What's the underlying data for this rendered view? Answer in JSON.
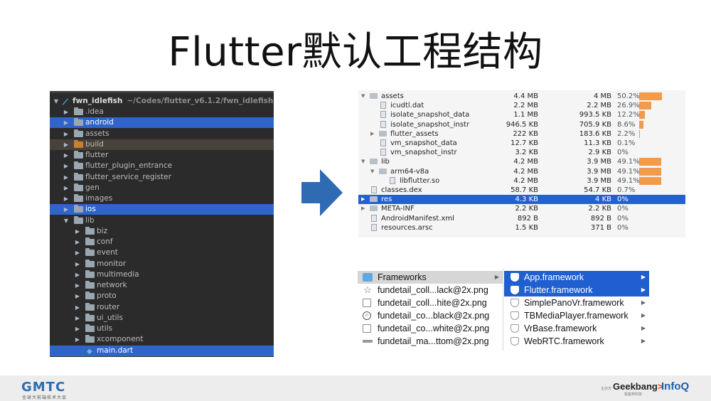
{
  "slide": {
    "title": "Flutter默认工程结构"
  },
  "ide_tree": {
    "root": {
      "name": "fwn_idlefish",
      "path": "~/Codes/flutter_v6.1.2/fwn_idlefish"
    },
    "items": [
      {
        "label": ".idea",
        "arrow": "▶"
      },
      {
        "label": "android",
        "arrow": "▶"
      },
      {
        "label": "assets",
        "arrow": "▶"
      },
      {
        "label": "build",
        "arrow": "▶"
      },
      {
        "label": "flutter",
        "arrow": "▶"
      },
      {
        "label": "flutter_plugin_entrance",
        "arrow": "▶"
      },
      {
        "label": "flutter_service_register",
        "arrow": "▶"
      },
      {
        "label": "gen",
        "arrow": "▶"
      },
      {
        "label": "images",
        "arrow": "▶"
      },
      {
        "label": "ios",
        "arrow": "▶"
      },
      {
        "label": "lib",
        "arrow": "▼"
      },
      {
        "label": "biz",
        "arrow": "▶"
      },
      {
        "label": "conf",
        "arrow": "▶"
      },
      {
        "label": "event",
        "arrow": "▶"
      },
      {
        "label": "monitor",
        "arrow": "▶"
      },
      {
        "label": "multimedia",
        "arrow": "▶"
      },
      {
        "label": "network",
        "arrow": "▶"
      },
      {
        "label": "proto",
        "arrow": "▶"
      },
      {
        "label": "router",
        "arrow": "▶"
      },
      {
        "label": "ui_utils",
        "arrow": "▶"
      },
      {
        "label": "utils",
        "arrow": "▶"
      },
      {
        "label": "xcomponent",
        "arrow": "▶"
      },
      {
        "label": "main.dart",
        "arrow": ""
      }
    ]
  },
  "apk_analyzer": {
    "rows": [
      {
        "name": "assets",
        "raw": "4.4 MB",
        "download": "4 MB",
        "pct": "50.2%",
        "bar": 0.502,
        "arrow": "▼"
      },
      {
        "name": "icudtl.dat",
        "raw": "2.2 MB",
        "download": "2.2 MB",
        "pct": "26.9%",
        "bar": 0.269,
        "arrow": ""
      },
      {
        "name": "isolate_snapshot_data",
        "raw": "1.1 MB",
        "download": "993.5 KB",
        "pct": "12.2%",
        "bar": 0.122,
        "arrow": ""
      },
      {
        "name": "isolate_snapshot_instr",
        "raw": "946.5 KB",
        "download": "705.9 KB",
        "pct": "8.6%",
        "bar": 0.086,
        "arrow": ""
      },
      {
        "name": "flutter_assets",
        "raw": "222 KB",
        "download": "183.6 KB",
        "pct": "2.2%",
        "bar": 0.022,
        "arrow": "▶"
      },
      {
        "name": "vm_snapshot_data",
        "raw": "12.7 KB",
        "download": "11.3 KB",
        "pct": "0.1%",
        "bar": 0,
        "arrow": ""
      },
      {
        "name": "vm_snapshot_instr",
        "raw": "3.2 KB",
        "download": "2.9 KB",
        "pct": "0%",
        "bar": 0,
        "arrow": ""
      },
      {
        "name": "lib",
        "raw": "4.2 MB",
        "download": "3.9 MB",
        "pct": "49.1%",
        "bar": 0.491,
        "arrow": "▼"
      },
      {
        "name": "arm64-v8a",
        "raw": "4.2 MB",
        "download": "3.9 MB",
        "pct": "49.1%",
        "bar": 0.491,
        "arrow": "▼"
      },
      {
        "name": "libflutter.so",
        "raw": "4.2 MB",
        "download": "3.9 MB",
        "pct": "49.1%",
        "bar": 0.491,
        "arrow": ""
      },
      {
        "name": "classes.dex",
        "raw": "58.7 KB",
        "download": "54.7 KB",
        "pct": "0.7%",
        "bar": 0,
        "arrow": ""
      },
      {
        "name": "res",
        "raw": "4.3 KB",
        "download": "4 KB",
        "pct": "0%",
        "bar": 0,
        "arrow": "▶"
      },
      {
        "name": "META-INF",
        "raw": "2.2 KB",
        "download": "2.2 KB",
        "pct": "0%",
        "bar": 0,
        "arrow": "▶"
      },
      {
        "name": "AndroidManifest.xml",
        "raw": "892 B",
        "download": "892 B",
        "pct": "0%",
        "bar": 0,
        "arrow": ""
      },
      {
        "name": "resources.arsc",
        "raw": "1.5 KB",
        "download": "371 B",
        "pct": "0%",
        "bar": 0,
        "arrow": ""
      }
    ]
  },
  "finder": {
    "column1": [
      {
        "label": "Frameworks",
        "icon": "folder-icon"
      },
      {
        "label": "fundetail_coll...lack@2x.png",
        "icon": "star-file-icon"
      },
      {
        "label": "fundetail_coll...hite@2x.png",
        "icon": "blank-file-icon"
      },
      {
        "label": "fundetail_co...black@2x.png",
        "icon": "smile-file-icon"
      },
      {
        "label": "fundetail_co...white@2x.png",
        "icon": "blank-file-icon"
      },
      {
        "label": "fundetail_ma...ttom@2x.png",
        "icon": "strip-file-icon"
      }
    ],
    "column2": [
      {
        "label": "App.framework"
      },
      {
        "label": "Flutter.framework"
      },
      {
        "label": "SimplePanoVr.framework"
      },
      {
        "label": "TBMediaPlayer.framework"
      },
      {
        "label": "VrBase.framework"
      },
      {
        "label": "WebRTC.framework"
      }
    ],
    "chevron": "▶"
  },
  "footer": {
    "gmtc": "GMTC",
    "gmtc_sub": "全球大前端技术大会",
    "by": "主办方",
    "geek_main": "Geekbang",
    "geek_accent": ">",
    "geek_sub": "极客邦科技",
    "infoq": "InfoQ"
  },
  "colors": {
    "ide_selection": "#2f65ca",
    "apk_selection": "#2260d4",
    "bar": "#f29b4b",
    "arrow": "#2f6bb3"
  }
}
